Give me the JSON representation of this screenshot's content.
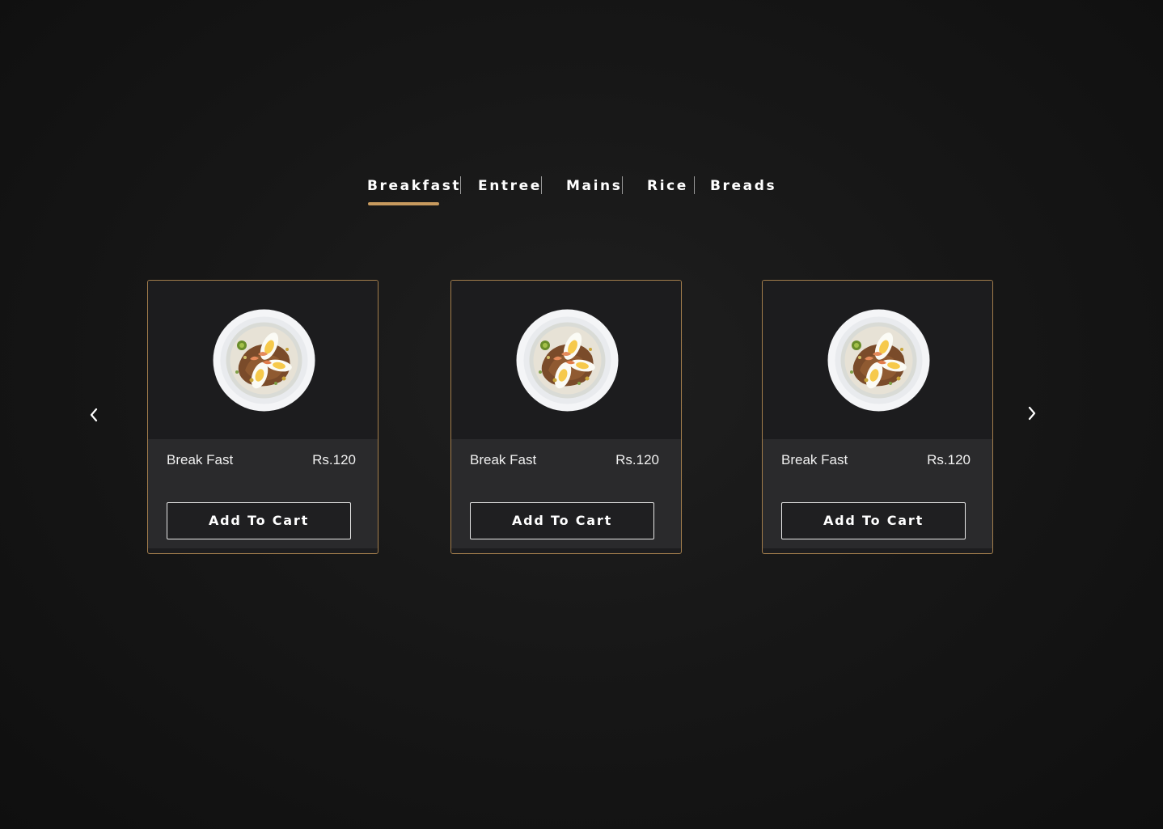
{
  "tabs": [
    {
      "label": "Breakfast",
      "active": true
    },
    {
      "label": "Entree",
      "active": false
    },
    {
      "label": "Mains",
      "active": false
    },
    {
      "label": "Rice",
      "active": false
    },
    {
      "label": "Breads",
      "active": false
    }
  ],
  "carousel": {
    "prev_icon": "chevron-left-icon",
    "next_icon": "chevron-right-icon"
  },
  "products": [
    {
      "name": "Break Fast",
      "price": "Rs.120",
      "button_label": "Add To Cart",
      "image": "food-plate-icon"
    },
    {
      "name": "Break Fast",
      "price": "Rs.120",
      "button_label": "Add To Cart",
      "image": "food-plate-icon"
    },
    {
      "name": "Break Fast",
      "price": "Rs.120",
      "button_label": "Add To Cart",
      "image": "food-plate-icon"
    }
  ],
  "colors": {
    "accent": "#c79a5e",
    "card_border": "#a27d4c",
    "background": "#171717",
    "card_body": "#2a2a2c"
  }
}
